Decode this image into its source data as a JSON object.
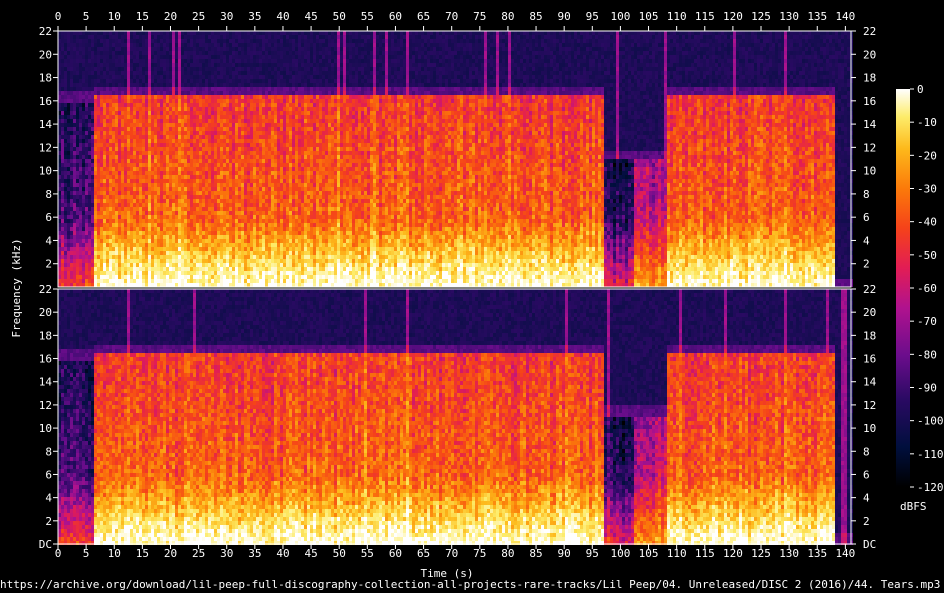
{
  "chart_data": {
    "type": "heatmap",
    "xlabel": "Time (s)",
    "ylabel": "Frequency (kHz)",
    "colorbar_label": "dBFS",
    "xlim": [
      0,
      141
    ],
    "ylim_khz": [
      0,
      22
    ],
    "x_ticks": [
      0,
      5,
      10,
      15,
      20,
      25,
      30,
      35,
      40,
      45,
      50,
      55,
      60,
      65,
      70,
      75,
      80,
      85,
      90,
      95,
      100,
      105,
      110,
      115,
      120,
      125,
      130,
      135,
      140
    ],
    "y_ticks_upper": [
      22,
      20,
      18,
      16,
      14,
      12,
      10,
      8,
      6,
      4,
      2
    ],
    "y_ticks_lower": [
      "22",
      "20",
      "18",
      "16",
      "14",
      "12",
      "10",
      "8",
      "6",
      "4",
      "2",
      "DC"
    ],
    "colorbar_ticks": [
      0,
      -10,
      -20,
      -30,
      -40,
      -50,
      -60,
      -70,
      -80,
      -90,
      -100,
      -110,
      -120
    ],
    "colorbar_range": [
      -120,
      0
    ],
    "channels": 2,
    "lowpass_cutoff_khz": 16,
    "audio_segments_s": [
      {
        "start": 0,
        "end": 6,
        "level": "quiet intro",
        "cutoff_khz": 16
      },
      {
        "start": 6,
        "end": 97,
        "level": "loud",
        "cutoff_khz": 16.5
      },
      {
        "start": 97,
        "end": 102,
        "level": "quiet",
        "cutoff_khz": 11
      },
      {
        "start": 102,
        "end": 108,
        "level": "medium",
        "cutoff_khz": 11
      },
      {
        "start": 108,
        "end": 138,
        "level": "loud",
        "cutoff_khz": 16.5
      },
      {
        "start": 138,
        "end": 141,
        "level": "silence",
        "cutoff_khz": 0
      }
    ],
    "colors": {
      "background": "#000000",
      "colormap": [
        "#000000",
        "#000f3d",
        "#2a0a63",
        "#6b0d8c",
        "#b0128e",
        "#e21d55",
        "#f5421a",
        "#fb7a0a",
        "#fdb91b",
        "#fdec6a",
        "#ffffff"
      ]
    }
  },
  "source_url": "https://archive.org/download/lil-peep-full-discography-collection-all-projects-rare-tracks/Lil Peep/04. Unreleased/DISC 2 (2016)/44. Tears.mp3"
}
